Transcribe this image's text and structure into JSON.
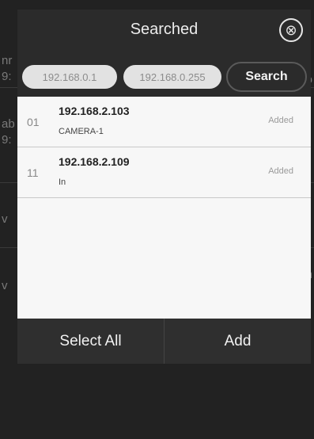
{
  "background": {
    "fragments": [
      "nr",
      "9:",
      "ab",
      "9:",
      "v",
      "v",
      "n",
      "o"
    ]
  },
  "dialog": {
    "title": "Searched",
    "close_icon": "⊗"
  },
  "search": {
    "start_ip": "192.168.0.1",
    "end_ip": "192.168.0.255",
    "button_label": "Search"
  },
  "devices": [
    {
      "index": "01",
      "ip": "192.168.2.103",
      "name": "CAMERA-1",
      "status": "Added"
    },
    {
      "index": "11",
      "ip": "192.168.2.109",
      "name": "In",
      "status": "Added"
    }
  ],
  "footer": {
    "select_all_label": "Select All",
    "add_label": "Add"
  }
}
